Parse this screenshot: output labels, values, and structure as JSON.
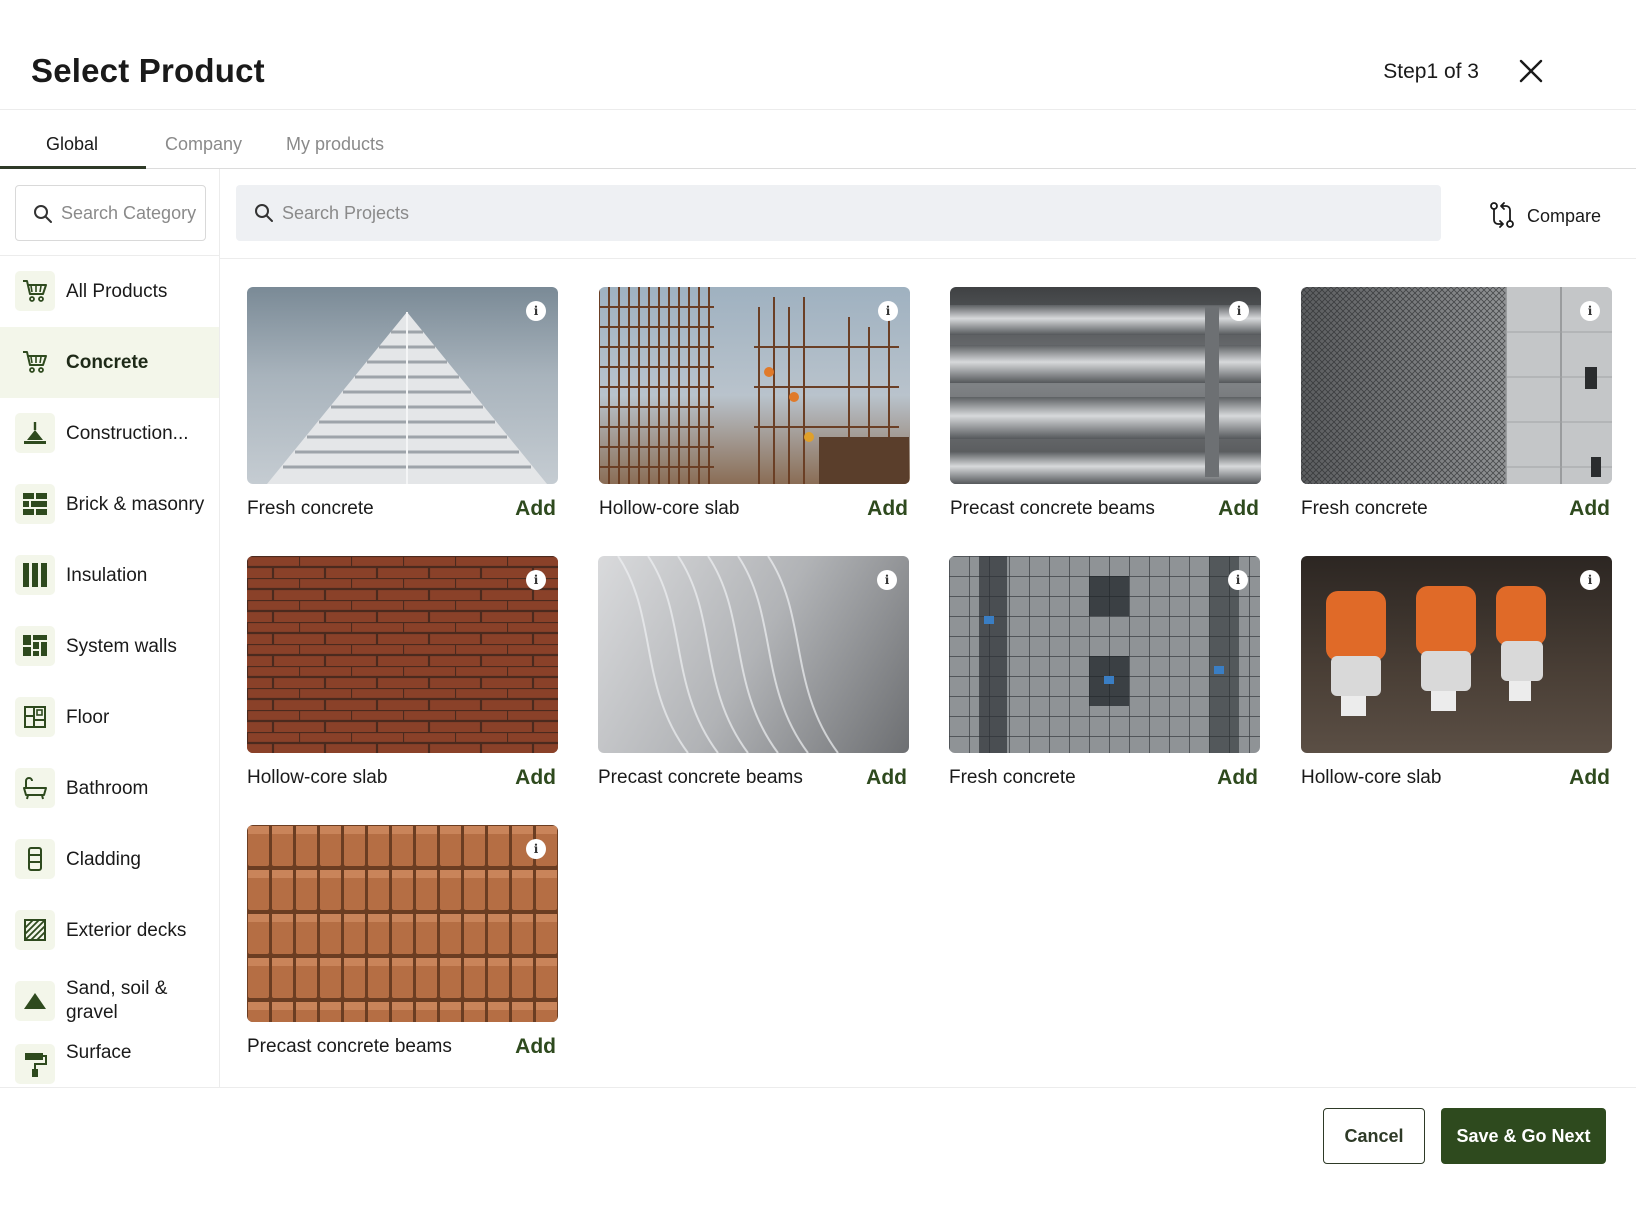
{
  "header": {
    "title": "Select Product",
    "step": "Step1 of 3"
  },
  "tabs": [
    {
      "label": "Global",
      "active": true
    },
    {
      "label": "Company",
      "active": false
    },
    {
      "label": "My products",
      "active": false
    }
  ],
  "sidebar": {
    "search_placeholder": "Search Category",
    "items": [
      {
        "label": "All Products",
        "icon": "cart-icon",
        "active": false
      },
      {
        "label": "Concrete",
        "icon": "cart-icon",
        "active": true
      },
      {
        "label": "Construction...",
        "icon": "crane-icon",
        "active": false
      },
      {
        "label": "Brick & masonry",
        "icon": "brick-icon",
        "active": false
      },
      {
        "label": "Insulation",
        "icon": "insulation-icon",
        "active": false
      },
      {
        "label": "System walls",
        "icon": "wall-panel-icon",
        "active": false
      },
      {
        "label": "Floor",
        "icon": "floor-plan-icon",
        "active": false
      },
      {
        "label": "Bathroom",
        "icon": "bathtub-icon",
        "active": false
      },
      {
        "label": "Cladding",
        "icon": "cladding-icon",
        "active": false
      },
      {
        "label": "Exterior decks",
        "icon": "deck-icon",
        "active": false
      },
      {
        "label": "Sand, soil & gravel",
        "icon": "triangle-icon",
        "active": false
      },
      {
        "label": "Surface",
        "icon": "paint-roller-icon",
        "active": false
      }
    ]
  },
  "search": {
    "placeholder": "Search Projects"
  },
  "compare_label": "Compare",
  "products": [
    {
      "name": "Fresh concrete",
      "add_label": "Add",
      "image": "concrete-pyramid"
    },
    {
      "name": "Hollow-core slab",
      "add_label": "Add",
      "image": "rebar-workers"
    },
    {
      "name": "Precast concrete beams",
      "add_label": "Add",
      "image": "steel-pipes"
    },
    {
      "name": "Fresh concrete",
      "add_label": "Add",
      "image": "mesh-wall"
    },
    {
      "name": "Hollow-core slab",
      "add_label": "Add",
      "image": "red-brick"
    },
    {
      "name": "Precast concrete beams",
      "add_label": "Add",
      "image": "grey-waves"
    },
    {
      "name": "Fresh concrete",
      "add_label": "Add",
      "image": "scaffold-facade"
    },
    {
      "name": "Hollow-core slab",
      "add_label": "Add",
      "image": "chainsaws"
    },
    {
      "name": "Precast concrete beams",
      "add_label": "Add",
      "image": "brick-stack"
    }
  ],
  "footer": {
    "cancel_label": "Cancel",
    "next_label": "Save & Go Next"
  },
  "colors": {
    "accent": "#2e4a1e",
    "accent_light": "#f3f6ea",
    "search_bg": "#eef0f3"
  }
}
